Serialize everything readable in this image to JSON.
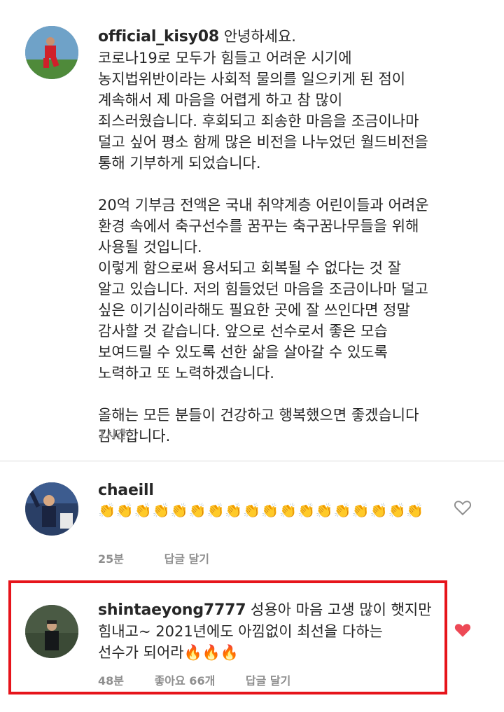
{
  "comments": [
    {
      "username": "official_kisy08",
      "text_first": "안녕하세요.",
      "text": "코로나19로 모두가 힘들고 어려운 시기에\n농지법위반이라는 사회적 물의를 일으키게 된 점이\n계속해서 제 마음을 어렵게 하고 참 많이\n죄스러웠습니다. 후회되고 죄송한 마음을 조금이나마\n덜고 싶어 평소 함께 많은 비전을 나누었던 월드비전을\n통해 기부하게 되었습니다.\n\n20억 기부금 전액은 국내 취약계층 어린이들과 어려운\n환경 속에서 축구선수를 꿈꾸는 축구꿈나무들을 위해\n사용될 것입니다.\n이렇게 함으로써 용서되고 회복될 수 없다는 것 잘\n알고 있습니다. 저의 힘들었던 마음을 조금이나마 덜고\n싶은 이기심이라해도 필요한 곳에 잘 쓰인다면 정말\n감사할 것 같습니다. 앞으로 선수로서 좋은 모습\n보여드릴 수 있도록 선한 삶을 살아갈 수 있도록\n노력하고 또 노력하겠습니다.\n\n올해는 모든 분들이 건강하고 행복했으면 좋겠습니다\n감사합니다.",
      "time": "1시간"
    },
    {
      "username": "chaeill",
      "clap_count": 18,
      "time": "25분",
      "reply": "답글 달기"
    },
    {
      "username": "shintaeyong7777",
      "text_first": "성용아 마음 고생 많이 햇지만",
      "text": "힘내고~  2021년에도 아낌없이 최선을 다하는\n선수가 되어라🔥🔥🔥",
      "time": "48분",
      "likes_label": "좋아요 66개",
      "reply": "답글 달기",
      "liked": true
    }
  ],
  "colors": {
    "highlight": "#e6141b",
    "heart_liked": "#ed4956",
    "meta": "#8e8e8e"
  }
}
